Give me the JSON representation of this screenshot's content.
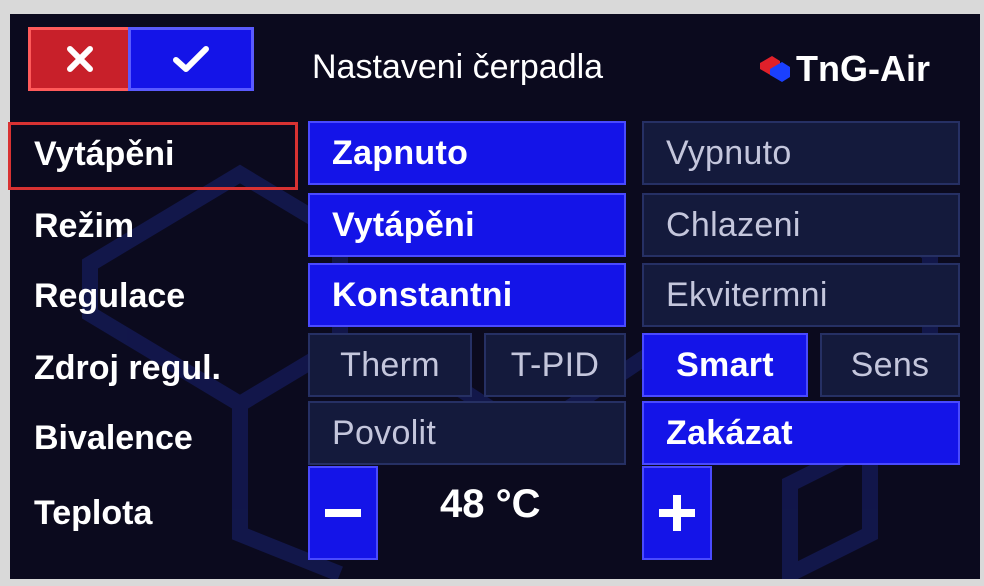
{
  "header": {
    "cancel_icon": "close-icon",
    "confirm_icon": "check-icon",
    "title": "Nastaveni čerpadla",
    "brand": "TnG-Air"
  },
  "rows": [
    {
      "label": "Vytápěni",
      "options": [
        "Zapnuto",
        "Vypnuto"
      ],
      "selected": "Zapnuto"
    },
    {
      "label": "Režim",
      "options": [
        "Vytápěni",
        "Chlazeni"
      ],
      "selected": "Vytápěni"
    },
    {
      "label": "Regulace",
      "options": [
        "Konstantni",
        "Ekvitermni"
      ],
      "selected": "Konstantni"
    },
    {
      "label": "Zdroj regul.",
      "options": [
        "Therm",
        "T-PID",
        "Smart",
        "Sens"
      ],
      "selected": "Smart"
    },
    {
      "label": "Bivalence",
      "options": [
        "Povolit",
        "Zakázat"
      ],
      "selected": "Zakázat"
    }
  ],
  "temperature": {
    "label": "Teplota",
    "value": "48 °C",
    "minus_icon": "minus-icon",
    "plus_icon": "plus-icon"
  },
  "colors": {
    "selected_bg": "#1414e8",
    "unselected_bg": "#141a3c",
    "cancel_bg": "#c8202a",
    "highlight_border": "#d83232",
    "screen_bg": "#0b0a1e"
  }
}
